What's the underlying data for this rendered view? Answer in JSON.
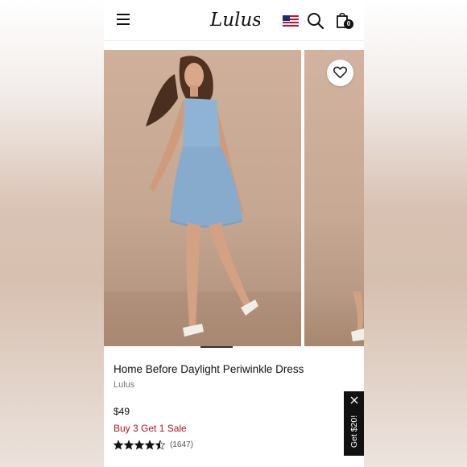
{
  "header": {
    "logo_text": "Lulus",
    "bag_count": "0",
    "icons": [
      "menu-icon",
      "us-flag-icon",
      "search-icon",
      "shopping-bag-icon"
    ]
  },
  "carousel": {
    "slides": [
      "model-in-periwinkle-dress-photo",
      "next-slide-photo"
    ],
    "active_index": 0
  },
  "product": {
    "title": "Home Before Daylight Periwinkle Dress",
    "brand": "Lulus",
    "price": "$49",
    "promo": "Buy 3 Get 1 Sale",
    "rating": 4.5,
    "rating_max": 5,
    "review_count": "(1647)"
  },
  "promo_tab": {
    "label": "Get $20!"
  },
  "colors": {
    "promo_red": "#b3122a",
    "dress_blue": "#8fb3d4",
    "background_tan": "#c6a791"
  }
}
